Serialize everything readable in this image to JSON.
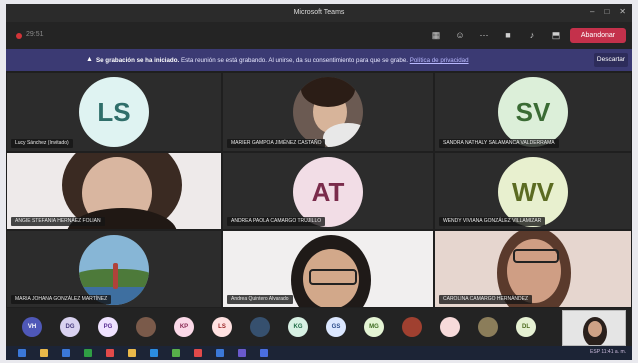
{
  "window": {
    "title": "Microsoft Teams",
    "min": "–",
    "max": "□",
    "close": "✕"
  },
  "meeting": {
    "timer": "29:51",
    "leave_label": "Abandonar"
  },
  "banner": {
    "title": "Se grabación se ha iniciado.",
    "text": "Esta reunión se está grabando. Al unirse, da su consentimiento para que se grabe.",
    "link": "Política de privacidad",
    "dismiss": "Descartar"
  },
  "participants": [
    {
      "name": "Lucy Sánchez (Invitado)",
      "initials": "LS",
      "type": "avatar",
      "bg": "#dff3f2",
      "fg": "#2f6e6a"
    },
    {
      "name": "MARIER GAMPOA JIMÉNEZ CASTAÑO",
      "initials": "",
      "type": "photo"
    },
    {
      "name": "SANDRA NATHALY SALAMANCA VALDERRAMA",
      "initials": "SV",
      "type": "avatar",
      "bg": "#dcefd9",
      "fg": "#3a6b34"
    },
    {
      "name": "ANGIE STEFANIA HERNÁEZ FOLIAN",
      "initials": "",
      "type": "camera"
    },
    {
      "name": "ANDREA PAOLA CAMARGO TRUJILLO",
      "initials": "AT",
      "type": "avatar",
      "bg": "#f2dde6",
      "fg": "#7a2b4b"
    },
    {
      "name": "WENDY VIVIANA GONZÁLEZ VILLAMIZAR",
      "initials": "WV",
      "type": "avatar",
      "bg": "#e8f0cf",
      "fg": "#5b6b22"
    },
    {
      "name": "MARIA JOHANA GONZÁLEZ MARTÍNEZ",
      "initials": "",
      "type": "photo2"
    },
    {
      "name": "Andrea Quintero Alvarado",
      "initials": "",
      "type": "camera2"
    },
    {
      "name": "CAROLINA CAMARGO HERNÁNDEZ",
      "initials": "",
      "type": "camera3"
    }
  ],
  "dock": {
    "chips": [
      {
        "initials": "VH",
        "bg": "#4f58b8",
        "fg": "#fff"
      },
      {
        "initials": "DG",
        "bg": "#d9d2f0",
        "fg": "#463a7d"
      },
      {
        "initials": "PG",
        "bg": "#efe2ff",
        "fg": "#5b2f95"
      },
      {
        "initials": "",
        "bg": "#7a5a4a",
        "fg": "#fff"
      },
      {
        "initials": "KP",
        "bg": "#fbd9e8",
        "fg": "#8a2a55"
      },
      {
        "initials": "LS",
        "bg": "#ffe1e1",
        "fg": "#922"
      },
      {
        "initials": "",
        "bg": "#36506e",
        "fg": "#fff"
      },
      {
        "initials": "KG",
        "bg": "#d7f0e3",
        "fg": "#1f6b45"
      },
      {
        "initials": "GS",
        "bg": "#dbe7ff",
        "fg": "#2a4b8a"
      },
      {
        "initials": "MG",
        "bg": "#e4f4d4",
        "fg": "#3d6b1f"
      },
      {
        "initials": "",
        "bg": "#a04030",
        "fg": "#fff"
      },
      {
        "initials": "",
        "bg": "#f7dada",
        "fg": "#8a2b2b"
      },
      {
        "initials": "",
        "bg": "#8b7d5a",
        "fg": "#fff"
      },
      {
        "initials": "DL",
        "bg": "#e6f1d3",
        "fg": "#4d6b1e"
      }
    ]
  },
  "taskbar": {
    "tray": "ESP  11:41 a. m."
  }
}
